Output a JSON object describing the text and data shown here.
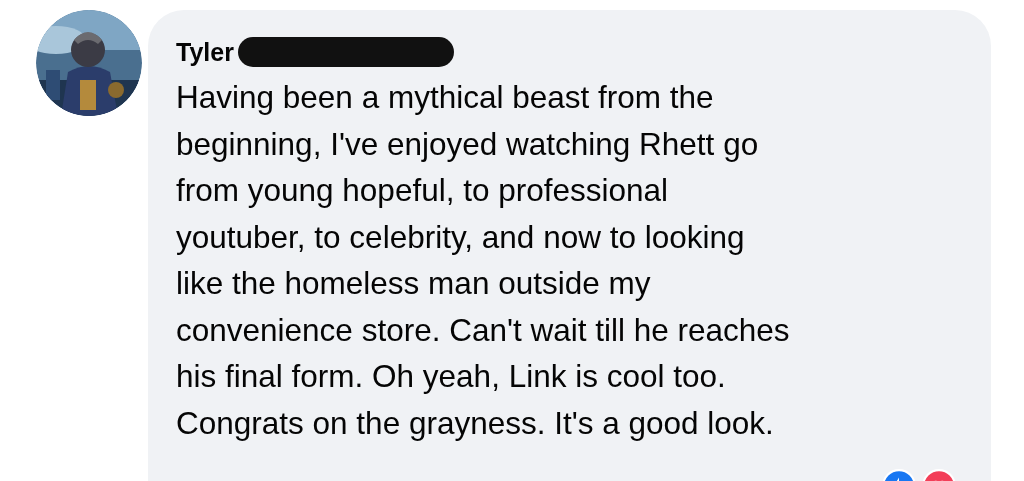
{
  "comment": {
    "author": "Tyler",
    "author_redacted": true,
    "body_lines": [
      "Having been a mythical beast from the",
      "beginning, I've enjoyed watching Rhett go",
      "from young hopeful, to professional",
      "youtuber, to celebrity, and now to looking",
      "like the homeless man outside my",
      "convenience store. Can't wait till he reaches",
      "his final form. Oh yeah, Link is cool too.",
      "Congrats on the grayness. It's a good look."
    ],
    "reactions": [
      {
        "kind": "like",
        "color": "#1877f2"
      },
      {
        "kind": "love",
        "color": "#f33e58"
      }
    ]
  }
}
